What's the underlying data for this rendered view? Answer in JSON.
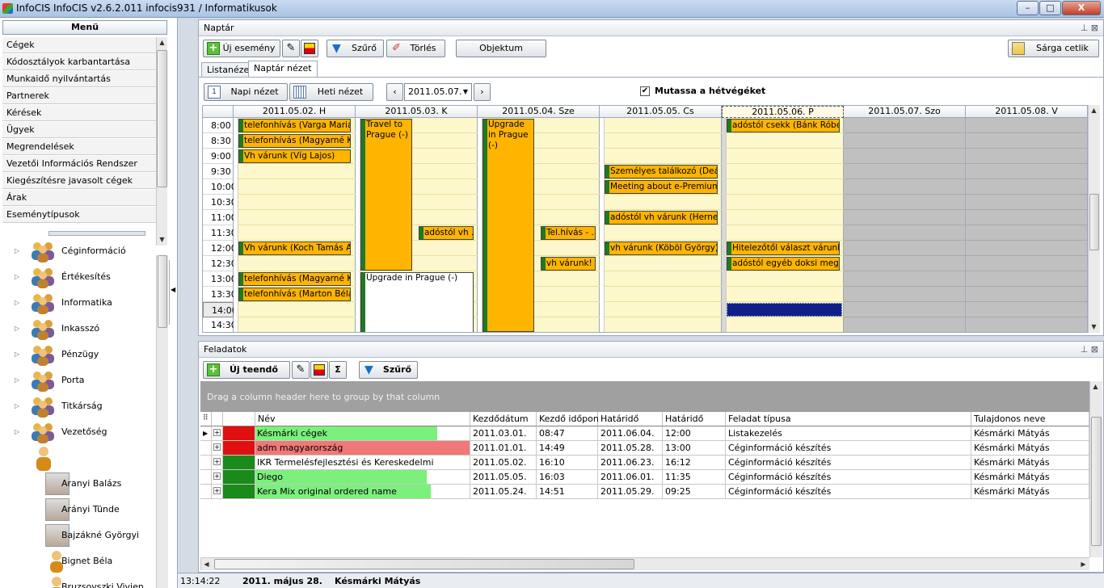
{
  "window": {
    "title": "InfoCIS InfoCIS v2.6.2.011 infocis931 / Informatikusok",
    "min": "–",
    "max": "□",
    "close": "X"
  },
  "menu": {
    "header": "Menü",
    "items": [
      "Cégek",
      "Kódosztályok karbantartása",
      "Munkaidő nyilvántartás",
      "Partnerek",
      "Kérések",
      "Ügyek",
      "Megrendelések",
      "Vezetői Információs Rendszer",
      "Kiegészítésre javasolt cégek",
      "Árak",
      "Eseménytípusok"
    ]
  },
  "tree": {
    "groups": [
      "Céginformáció",
      "Értékesítés",
      "Informatika",
      "Inkasszó",
      "Pénzügy",
      "Porta",
      "Titkárság",
      "Vezetőség"
    ],
    "persons": [
      "Aranyi Balázs",
      "Arányi Tünde",
      "Bajzákné Györgyi",
      "Bignet Béla",
      "Bruzsovszki Vivien"
    ]
  },
  "calendar": {
    "panel_title": "Naptár",
    "toolbar": {
      "new_event": "Új esemény",
      "filter": "Szűrő",
      "delete": "Törlés",
      "object": "Objektum",
      "sticky": "Sárga cetlik"
    },
    "tabs": [
      "Listanézet",
      "Naptár nézet"
    ],
    "daily": "Napi nézet",
    "weekly": "Heti nézet",
    "date": "2011.05.07.",
    "weekend_label": "Mutassa a hétvégéket",
    "days": [
      "2011.05.02. H",
      "2011.05.03. K",
      "2011.05.04. Sze",
      "2011.05.05. Cs",
      "2011.05.06. P",
      "2011.05.07. Szo",
      "2011.05.08. V"
    ],
    "times": [
      "8:00",
      "8:30",
      "9:00",
      "9:30",
      "10:00",
      "10:30",
      "11:00",
      "11:30",
      "12:00",
      "12:30",
      "13:00",
      "13:30",
      "14:00",
      "14:30"
    ],
    "events": [
      {
        "text": "telefonhívás (Varga Mariann)"
      },
      {
        "text": "telefonhívás (Magyarné Kó..."
      },
      {
        "text": "Vh várunk  (Víg Lajos)"
      },
      {
        "text": "Vh várunk (Koch Tamás A..."
      },
      {
        "text": "telefonhívás (Magyarné Kó..."
      },
      {
        "text": "telefonhívás (Marton Béláné)"
      },
      {
        "text": "Travel to Prague (-)"
      },
      {
        "text": "adóstól vh ..."
      },
      {
        "text": "Upgrade in Prague (-)"
      },
      {
        "text": "Upgrade in Prague (-)"
      },
      {
        "text": "Tel.hívás - ..."
      },
      {
        "text": "vh várunk! ..."
      },
      {
        "text": "Személyes találkozó (Deák ..."
      },
      {
        "text": "Meeting about e-Premium ..."
      },
      {
        "text": "adóstól vh várunk (Hernesz..."
      },
      {
        "text": "vh várunk (Köböl György)"
      },
      {
        "text": "adóstól csekk  (Bánk Róbe..."
      },
      {
        "text": "Hitelezőtől választ várunk ..."
      },
      {
        "text": "adóstól egyéb doksi megkü..."
      }
    ]
  },
  "tasks": {
    "panel_title": "Feladatok",
    "toolbar": {
      "new": "Új teendő",
      "sigma": "Σ",
      "filter": "Szűrő"
    },
    "group_hint": "Drag a column header here to group by that column",
    "columns": [
      "Név",
      "Kezdődátum",
      "Kezdő időpont",
      "Határidő",
      "Határidő",
      "Feladat típusa",
      "Tulajdonos neve"
    ],
    "rows": [
      {
        "name": "Késmárki cégek",
        "start": "2011.03.01.",
        "time": "08:47",
        "due": "2011.06.04.",
        "duetime": "12:00",
        "type": "Listakezelés",
        "owner": "Késmárki Mátyás",
        "status": "#e01010",
        "bar": "#7cf07c",
        "barw": 0.85
      },
      {
        "name": "adm magyarország",
        "start": "2011.01.01.",
        "time": "14:49",
        "due": "2011.05.28.",
        "duetime": "13:00",
        "type": "Céginformáció készítés",
        "owner": "Késmárki Mátyás",
        "status": "#e01010",
        "bar": "#f07878",
        "barw": 1
      },
      {
        "name": "IKR Termelésfejlesztési és Kereskedelmi",
        "start": "2011.05.02.",
        "time": "16:10",
        "due": "2011.06.23.",
        "duetime": "16:12",
        "type": "Céginformáció készítés",
        "owner": "Késmárki Mátyás",
        "status": "#1a8a1a",
        "bar": "#ffffff",
        "barw": 0
      },
      {
        "name": "Diego",
        "start": "2011.05.05.",
        "time": "16:03",
        "due": "2011.06.01.",
        "duetime": "11:35",
        "type": "Céginformáció készítés",
        "owner": "Késmárki Mátyás",
        "status": "#1a8a1a",
        "bar": "#7cf07c",
        "barw": 0.8
      },
      {
        "name": "Kera Mix original ordered name",
        "start": "2011.05.24.",
        "time": "14:51",
        "due": "2011.05.29.",
        "duetime": "09:25",
        "type": "Céginformáció készítés",
        "owner": "Késmárki Mátyás",
        "status": "#1a8a1a",
        "bar": "#7cf07c",
        "barw": 0.82
      }
    ]
  },
  "status": {
    "time": "13:14:22",
    "date": "2011. május 28.",
    "user": "Késmárki Mátyás"
  }
}
